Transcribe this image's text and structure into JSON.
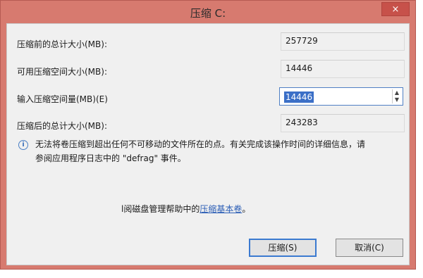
{
  "window": {
    "title": "压缩 C:",
    "close_glyph": "×"
  },
  "fields": [
    {
      "label": "压缩前的总计大小(MB):",
      "value": "257729"
    },
    {
      "label": "可用压缩空间大小(MB):",
      "value": "14446"
    },
    {
      "label": "输入压缩空间量(MB)(E)",
      "value": "14446"
    },
    {
      "label": "压缩后的总计大小(MB):",
      "value": "243283"
    }
  ],
  "spinner": {
    "up": "▲",
    "down": "▼"
  },
  "info": {
    "icon": "i",
    "line1": "无法将卷压缩到超出任何不可移动的文件所在的点。有关完成该操作时间的详细信息，请",
    "line2": "参阅应用程序日志中的 \"defrag\" 事件。"
  },
  "help": {
    "prefix": "l阅磁盘管理帮助中的",
    "link": "压缩基本卷",
    "suffix": "。"
  },
  "buttons": {
    "shrink": "压缩(S)",
    "cancel": "取消(C)"
  }
}
